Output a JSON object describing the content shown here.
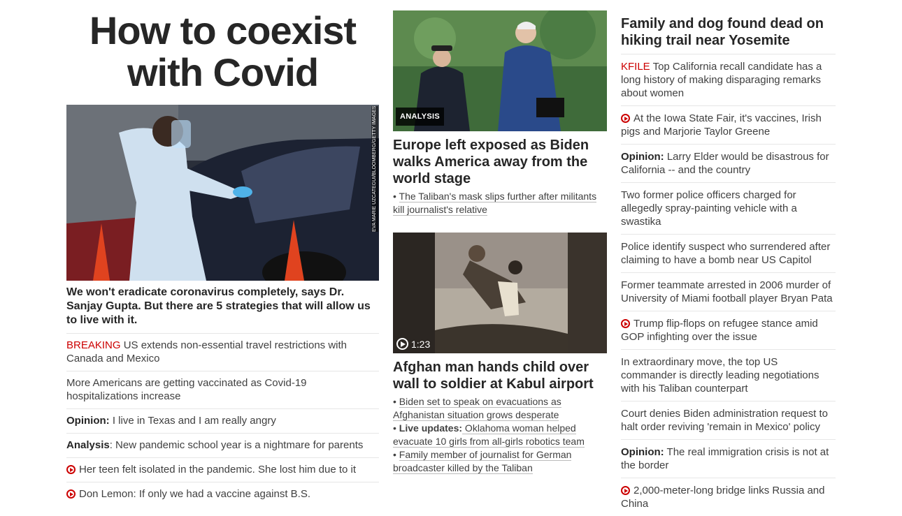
{
  "hero": {
    "title": "How to coexist with Covid",
    "image_credit": "EVA MARIE UZCATEGUI/BLOOMBERG/GETTY IMAGES",
    "caption": "We won't eradicate coronavirus completely, says Dr. Sanjay Gupta. But there are 5 strategies that will allow us to live with it."
  },
  "col1_list": [
    {
      "kicker": "BREAKING",
      "kicker_style": "red",
      "text": " US extends non-essential travel restrictions with Canada and Mexico"
    },
    {
      "kicker": "",
      "kicker_style": "",
      "text": "More Americans are getting vaccinated as Covid-19 hospitalizations increase"
    },
    {
      "kicker": "Opinion:",
      "kicker_style": "bold",
      "text": " I live in Texas and I am really angry"
    },
    {
      "kicker": "Analysis",
      "kicker_style": "bold",
      "text": ": New pandemic school year is a nightmare for parents"
    },
    {
      "kicker": "",
      "kicker_style": "video",
      "text": "Her teen felt isolated in the pandemic. She lost him due to it"
    },
    {
      "kicker": "",
      "kicker_style": "video",
      "text": "Don Lemon: If only we had a vaccine against B.S."
    }
  ],
  "story1": {
    "badge": "ANALYSIS",
    "title": "Europe left exposed as Biden walks America away from the world stage",
    "links": [
      {
        "bold": "",
        "text": "The Taliban's mask slips further after militants kill journalist's relative"
      }
    ]
  },
  "story2": {
    "duration": "1:23",
    "title": "Afghan man hands child over wall to soldier at Kabul airport",
    "links": [
      {
        "bold": "",
        "text": "Biden set to speak on evacuations as Afghanistan situation grows desperate"
      },
      {
        "bold": "Live updates:",
        "text": " Oklahoma woman helped evacuate 10 girls from all-girls robotics team"
      },
      {
        "bold": "",
        "text": "Family member of journalist for German broadcaster killed by the Taliban"
      }
    ]
  },
  "col3": {
    "title": "Family and dog found dead on hiking trail near Yosemite",
    "list": [
      {
        "kicker": "KFILE",
        "kicker_style": "red",
        "text": " Top California recall candidate has a long history of making disparaging remarks about women"
      },
      {
        "kicker": "",
        "kicker_style": "video",
        "text": "At the Iowa State Fair, it's vaccines, Irish pigs and Marjorie Taylor Greene"
      },
      {
        "kicker": "Opinion:",
        "kicker_style": "bold",
        "text": " Larry Elder would be disastrous for California -- and the country"
      },
      {
        "kicker": "",
        "kicker_style": "",
        "text": "Two former police officers charged for allegedly spray-painting vehicle with a swastika"
      },
      {
        "kicker": "",
        "kicker_style": "",
        "text": "Police identify suspect who surrendered after claiming to have a bomb near US Capitol"
      },
      {
        "kicker": "",
        "kicker_style": "",
        "text": "Former teammate arrested in 2006 murder of University of Miami football player Bryan Pata"
      },
      {
        "kicker": "",
        "kicker_style": "video",
        "text": "Trump flip-flops on refugee stance amid GOP infighting over the issue"
      },
      {
        "kicker": "",
        "kicker_style": "",
        "text": "In extraordinary move, the top US commander is directly leading negotiations with his Taliban counterpart"
      },
      {
        "kicker": "",
        "kicker_style": "",
        "text": "Court denies Biden administration request to halt order reviving 'remain in Mexico' policy"
      },
      {
        "kicker": "Opinion:",
        "kicker_style": "bold",
        "text": " The real immigration crisis is not at the border"
      },
      {
        "kicker": "",
        "kicker_style": "video",
        "text": "2,000-meter-long bridge links Russia and China"
      }
    ]
  },
  "colors": {
    "accent_red": "#cc0000",
    "text": "#262626",
    "divider": "#e6e6e6"
  }
}
